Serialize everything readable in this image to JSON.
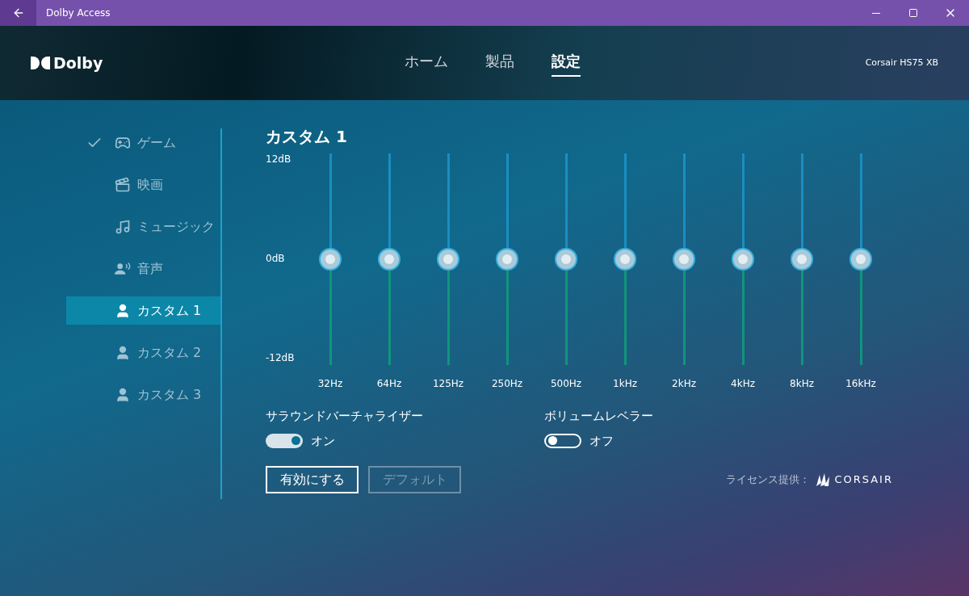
{
  "window": {
    "title": "Dolby Access"
  },
  "header": {
    "logo": "Dolby",
    "nav": [
      {
        "label": "ホーム",
        "selected": false
      },
      {
        "label": "製品",
        "selected": false
      },
      {
        "label": "設定",
        "selected": true
      }
    ],
    "device": "Corsair HS75 XB"
  },
  "sidebar": {
    "items": [
      {
        "label": "ゲーム",
        "kind": "gamepad",
        "checked": true,
        "selected": false
      },
      {
        "label": "映画",
        "kind": "film",
        "checked": false,
        "selected": false
      },
      {
        "label": "ミュージック",
        "kind": "music",
        "checked": false,
        "selected": false
      },
      {
        "label": "音声",
        "kind": "voice",
        "checked": false,
        "selected": false
      },
      {
        "label": "カスタム 1",
        "kind": "person",
        "checked": false,
        "selected": true
      },
      {
        "label": "カスタム 2",
        "kind": "person",
        "checked": false,
        "selected": false
      },
      {
        "label": "カスタム 3",
        "kind": "person",
        "checked": false,
        "selected": false
      }
    ]
  },
  "equalizer": {
    "title": "カスタム 1",
    "scale": [
      "12dB",
      "0dB",
      "-12dB"
    ],
    "bands": [
      {
        "label": "32Hz",
        "level": 0.5
      },
      {
        "label": "64Hz",
        "level": 0.5
      },
      {
        "label": "125Hz",
        "level": 0.5
      },
      {
        "label": "250Hz",
        "level": 0.5
      },
      {
        "label": "500Hz",
        "level": 0.5
      },
      {
        "label": "1kHz",
        "level": 0.5
      },
      {
        "label": "2kHz",
        "level": 0.5
      },
      {
        "label": "4kHz",
        "level": 0.5
      },
      {
        "label": "8kHz",
        "level": 0.5
      },
      {
        "label": "16kHz",
        "level": 0.5
      }
    ]
  },
  "toggles": [
    {
      "label": "サラウンドバーチャライザー",
      "on": true,
      "state_text": "オン"
    },
    {
      "label": "ボリュームレベラー",
      "on": false,
      "state_text": "オフ"
    }
  ],
  "buttons": [
    {
      "label": "有効にする",
      "disabled": false
    },
    {
      "label": "デフォルト",
      "disabled": true
    }
  ],
  "license": {
    "text": "ライセンス提供：",
    "brand": "CORSAIR"
  }
}
